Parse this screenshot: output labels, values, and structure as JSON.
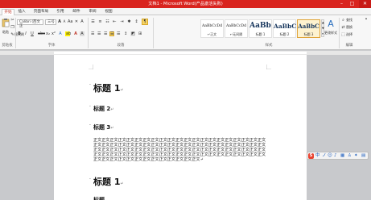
{
  "window": {
    "title": "文档1 - Microsoft Word(产品激活失败)"
  },
  "tabs": [
    "开始",
    "插入",
    "页面布局",
    "引用",
    "邮件",
    "审阅",
    "视图"
  ],
  "clipboard": {
    "paste": "粘贴",
    "cut": "剪切",
    "copy": "复制",
    "format": "格式刷",
    "label": "剪贴板"
  },
  "font": {
    "name": "Calibri (西文正",
    "size": "三号",
    "label": "字体"
  },
  "paragraph": {
    "label": "段落"
  },
  "styles": {
    "label": "样式",
    "items": [
      {
        "preview": "AaBbCcDd",
        "name": "↵正文"
      },
      {
        "preview": "AaBbCcDd",
        "name": "↵无间隔"
      },
      {
        "preview": "AaBb",
        "name": "标题 1"
      },
      {
        "preview": "AaBbC",
        "name": "标题 2"
      },
      {
        "preview": "AaBbC",
        "name": "标题 3"
      }
    ],
    "change": "更改样式"
  },
  "editing": {
    "find": "查找",
    "replace": "替换",
    "select": "选择",
    "label": "编辑"
  },
  "document": {
    "h1_a": "标题 1",
    "h2": "标题 2",
    "h3": "标题 3",
    "paragraph": "正文正文正文正文正文正文正文正文正文正文正文正文正文正文正文正文正文正文正文正文正文正文正文正文正文正文正文正文正文正文正文正文正文正文正文正文正文正文正文正文正文正文正文正文正文正文正文正文正文正文正文正文正文正文正文正文正文正文正文正文正文正文正文正文正文正文正文正文正文正文正文正文正文正文正文正文正文正文正文正文正文正文正文正文正文正文正文正文正文正文正文正文正文正文正文正文正文↵",
    "h1_b": "标题 1",
    "h2_b": "标题"
  },
  "ime": {
    "logo": "S",
    "mode": "中",
    "punct": "ノ"
  },
  "colors": {
    "titlebar": "#d9241f",
    "accent": "#c0392b"
  }
}
